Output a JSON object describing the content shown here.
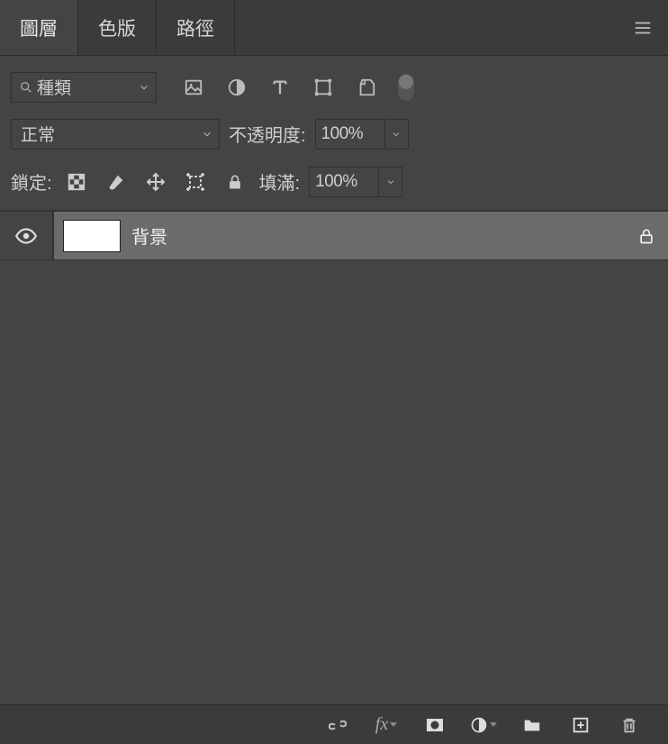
{
  "tabs": {
    "layers": "圖層",
    "channels": "色版",
    "paths": "路徑"
  },
  "kind_select_label": "種類",
  "blend_mode": "正常",
  "opacity_label": "不透明度:",
  "opacity_value": "100%",
  "lock_label": "鎖定:",
  "fill_label": "填滿:",
  "fill_value": "100%",
  "layers": [
    {
      "name": "背景"
    }
  ],
  "footer": {
    "fx": "fx"
  }
}
